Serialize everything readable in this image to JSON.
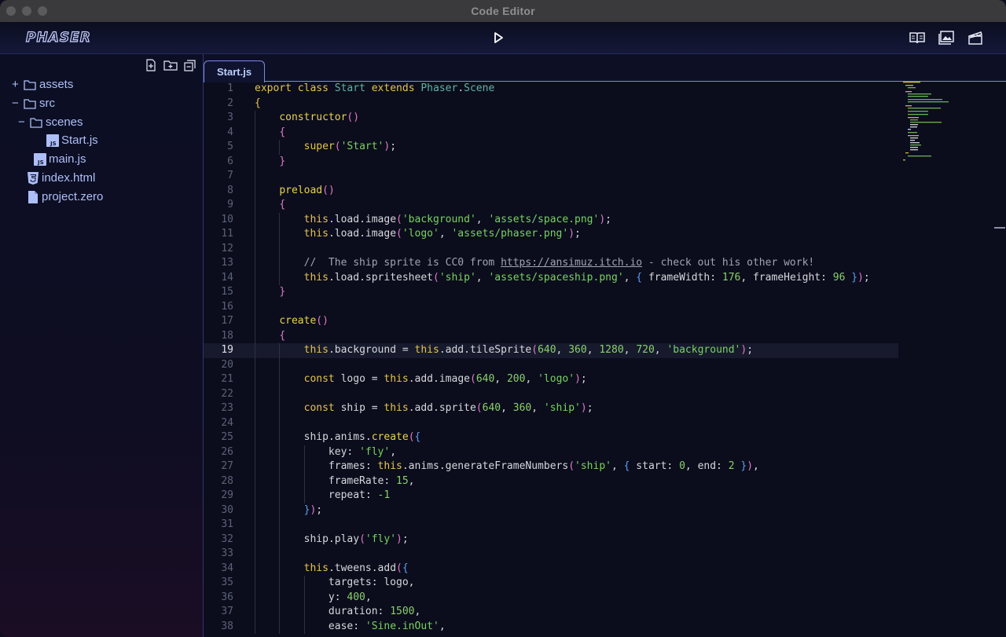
{
  "window": {
    "title": "Code Editor"
  },
  "toolbar": {
    "logo_text": "PHASER",
    "play": "play-icon",
    "right_icons": [
      "book-icon",
      "images-icon",
      "clapperboard-icon"
    ]
  },
  "sidebar": {
    "actions": [
      "new-file-icon",
      "new-folder-icon",
      "collapse-all-icon"
    ],
    "tree": [
      {
        "label": "assets",
        "toggle": "+",
        "icon": "folder-icon"
      },
      {
        "label": "src",
        "toggle": "−",
        "icon": "folder-icon"
      },
      {
        "label": "scenes",
        "toggle": "−",
        "icon": "folder-icon"
      },
      {
        "label": "Start.js",
        "icon": "js-file-icon"
      },
      {
        "label": "main.js",
        "icon": "js-file-icon"
      },
      {
        "label": "index.html",
        "icon": "html5-file-icon"
      },
      {
        "label": "project.zero",
        "icon": "file-icon"
      }
    ]
  },
  "editor": {
    "tab": "Start.js",
    "current_line": 19,
    "lines": [
      "export class Start extends Phaser.Scene",
      "{",
      "    constructor()",
      "    {",
      "        super('Start');",
      "    }",
      "",
      "    preload()",
      "    {",
      "        this.load.image('background', 'assets/space.png');",
      "        this.load.image('logo', 'assets/phaser.png');",
      "",
      "        //  The ship sprite is CC0 from https://ansimuz.itch.io - check out his other work!",
      "        this.load.spritesheet('ship', 'assets/spaceship.png', { frameWidth: 176, frameHeight: 96 });",
      "    }",
      "",
      "    create()",
      "    {",
      "        this.background = this.add.tileSprite(640, 360, 1280, 720, 'background');",
      "",
      "        const logo = this.add.image(640, 200, 'logo');",
      "",
      "        const ship = this.add.sprite(640, 360, 'ship');",
      "",
      "        ship.anims.create({",
      "            key: 'fly',",
      "            frames: this.anims.generateFrameNumbers('ship', { start: 0, end: 2 }),",
      "            frameRate: 15,",
      "            repeat: -1",
      "        });",
      "",
      "        ship.play('fly');",
      "",
      "        this.tweens.add({",
      "            targets: logo,",
      "            y: 400,",
      "            duration: 1500,",
      "            ease: 'Sine.inOut',"
    ]
  },
  "colors": {
    "keyword": "#e6c34f",
    "class_name": "#5fb3a8",
    "string": "#78d35e",
    "number": "#8ad06a",
    "paren": "#e07ac8",
    "brace": "#5c9ef2",
    "comment": "#a1a3b0",
    "accent": "#7b8be0"
  }
}
